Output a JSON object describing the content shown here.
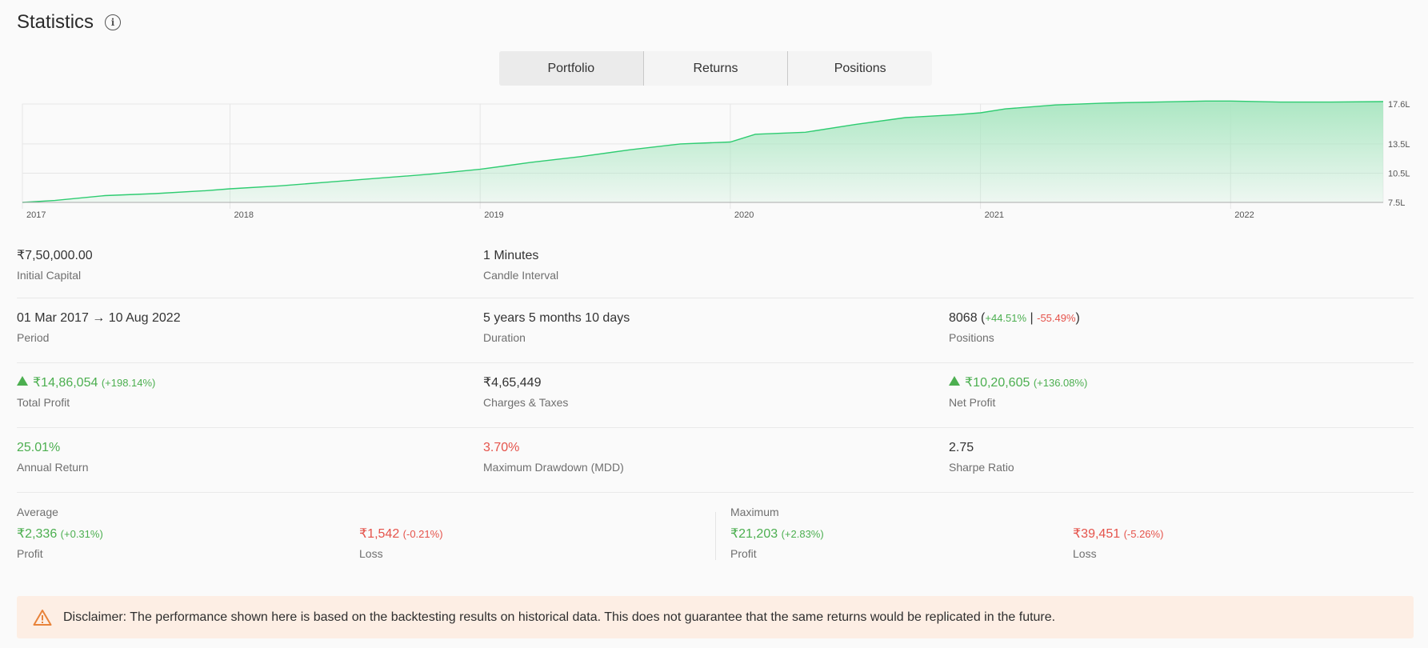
{
  "header": {
    "title": "Statistics",
    "info_icon": "info-icon"
  },
  "tabs": [
    {
      "label": "Portfolio",
      "active": true
    },
    {
      "label": "Returns",
      "active": false
    },
    {
      "label": "Positions",
      "active": false
    }
  ],
  "chart_data": {
    "type": "area",
    "x_ticks": [
      "2017",
      "2018",
      "2019",
      "2020",
      "2021",
      "2022"
    ],
    "y_ticks": [
      "17.6L",
      "13.5L",
      "10.5L",
      "7.5L"
    ],
    "y_tick_values": [
      17.6,
      13.5,
      10.5,
      7.5
    ],
    "ylim": [
      7.5,
      17.6
    ],
    "xlim": [
      2017.17,
      2022.61
    ],
    "grid": true,
    "line_color": "#2ecc71",
    "fill_color": "#a8e6c0",
    "x": [
      2017.17,
      2017.3,
      2017.5,
      2017.7,
      2017.9,
      2018.0,
      2018.2,
      2018.4,
      2018.6,
      2018.8,
      2019.0,
      2019.2,
      2019.4,
      2019.6,
      2019.8,
      2020.0,
      2020.1,
      2020.3,
      2020.5,
      2020.7,
      2020.9,
      2021.0,
      2021.1,
      2021.3,
      2021.5,
      2021.7,
      2021.9,
      2022.0,
      2022.2,
      2022.4,
      2022.61
    ],
    "values": [
      7.5,
      7.7,
      8.2,
      8.4,
      8.7,
      8.9,
      9.2,
      9.6,
      10.0,
      10.4,
      10.9,
      11.6,
      12.2,
      12.9,
      13.5,
      13.7,
      14.5,
      14.7,
      15.5,
      16.2,
      16.5,
      16.7,
      17.1,
      17.5,
      17.7,
      17.8,
      17.9,
      17.9,
      17.8,
      17.8,
      17.85
    ]
  },
  "stats": {
    "initial_capital": {
      "value": "₹7,50,000.00",
      "label": "Initial Capital"
    },
    "candle_interval": {
      "value": "1 Minutes",
      "label": "Candle Interval"
    },
    "period": {
      "value": "01 Mar 2017 → 10 Aug 2022",
      "label": "Period"
    },
    "duration": {
      "value": "5 years 5 months 10 days",
      "label": "Duration"
    },
    "positions": {
      "value": "8068",
      "open_paren": "(",
      "win_pct": "+44.51%",
      "sep": "|",
      "loss_pct": "-55.49%",
      "close_paren": ")",
      "label": "Positions"
    },
    "total_profit": {
      "value": "₹14,86,054",
      "pct": "(+198.14%)",
      "label": "Total Profit"
    },
    "charges": {
      "value": "₹4,65,449",
      "label": "Charges & Taxes"
    },
    "net_profit": {
      "value": "₹10,20,605",
      "pct": "(+136.08%)",
      "label": "Net Profit"
    },
    "annual_return": {
      "value": "25.01%",
      "label": "Annual Return"
    },
    "mdd": {
      "value": "3.70%",
      "label": "Maximum Drawdown (MDD)"
    },
    "sharpe": {
      "value": "2.75",
      "label": "Sharpe Ratio"
    }
  },
  "average": {
    "title": "Average",
    "profit": {
      "value": "₹2,336",
      "pct": "(+0.31%)",
      "label": "Profit"
    },
    "loss": {
      "value": "₹1,542",
      "pct": "(-0.21%)",
      "label": "Loss"
    }
  },
  "maximum": {
    "title": "Maximum",
    "profit": {
      "value": "₹21,203",
      "pct": "(+2.83%)",
      "label": "Profit"
    },
    "loss": {
      "value": "₹39,451",
      "pct": "(-5.26%)",
      "label": "Loss"
    }
  },
  "disclaimer": {
    "icon": "warning-icon",
    "text": "Disclaimer: The performance shown here is based on the backtesting results on historical data. This does not guarantee that the same returns would be replicated in the future."
  }
}
